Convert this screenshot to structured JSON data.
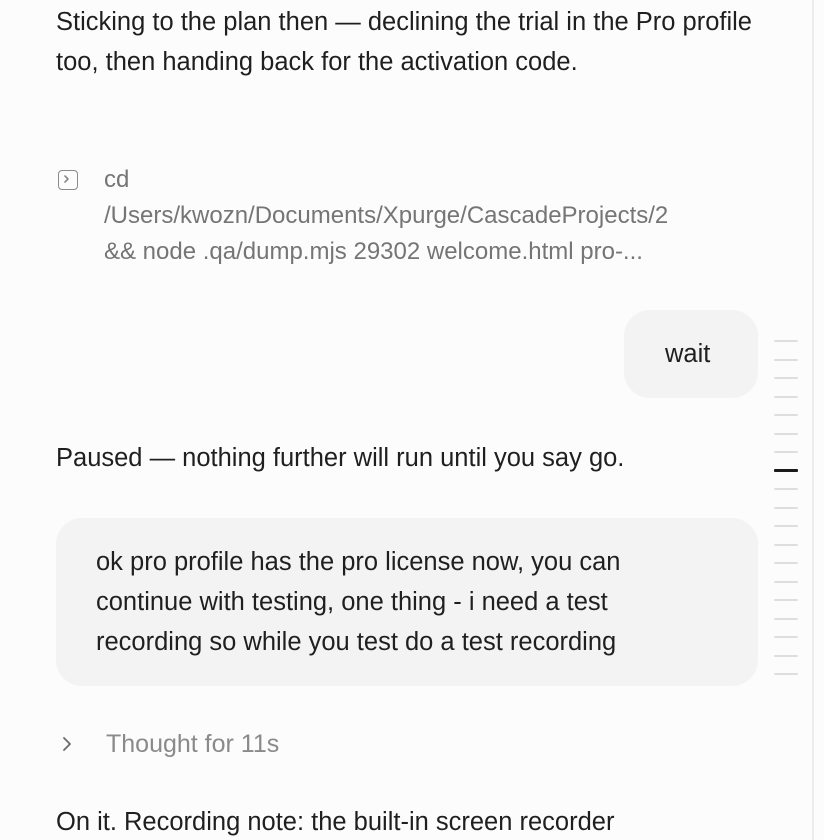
{
  "messages": {
    "assistant_1": "Sticking to the plan then — declining the trial in the Pro profile too, then handing back for the activation code.",
    "command": {
      "icon": "terminal-icon",
      "line1": "cd",
      "line2": "/Users/kwozn/Documents/Xpurge/CascadeProjects/2",
      "line3": "&& node .qa/dump.mjs 29302 welcome.html pro-..."
    },
    "user_1": "wait",
    "assistant_2": "Paused — nothing further will run until you say go.",
    "user_2": "ok pro profile has the pro license now, you can continue with testing, one thing - i need a test recording so while you test do a test recording",
    "thought": {
      "icon": "chevron-right-icon",
      "label": "Thought for 11s"
    },
    "assistant_3": "On it. Recording note: the built-in screen recorder"
  },
  "colors": {
    "background": "#fcfcfc",
    "bubble": "#f3f3f3",
    "text": "#1f1f1f",
    "muted": "#757575"
  },
  "minimap": {
    "tick_count": 19,
    "active_index": 7
  }
}
